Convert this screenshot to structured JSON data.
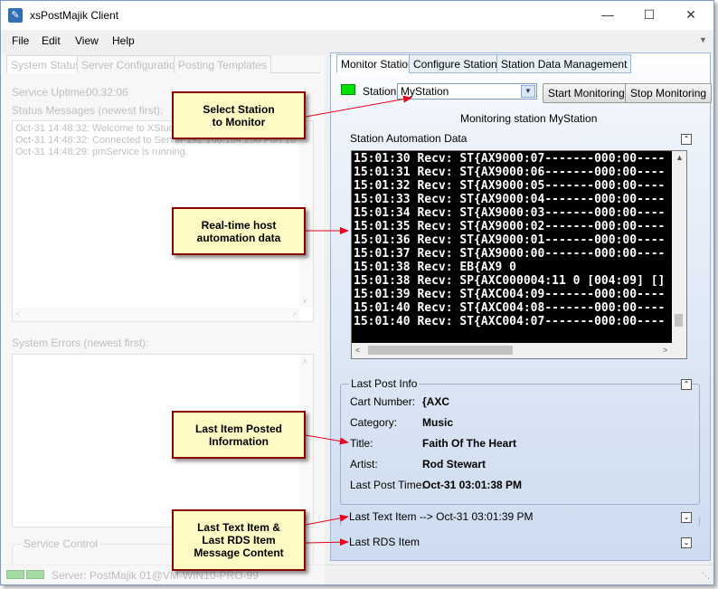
{
  "window": {
    "title": "xsPostMajik Client",
    "controls": [
      "minimize-icon",
      "maximize-icon",
      "close-icon"
    ]
  },
  "menu": [
    "File",
    "Edit",
    "View",
    "Help"
  ],
  "left_panel": {
    "tabs": [
      "System Status",
      "Server Configuration",
      "Posting Templates"
    ],
    "uptime_label": "Service Uptime:",
    "uptime_value": "00:32:06",
    "status_messages_label": "Status Messages (newest first):",
    "status_messages": [
      "Oct-31 14:48:32: Welcome to XStudio",
      "Oct-31 14:48:32: Connected to Server 192.168.184.250 Port 10",
      "Oct-31 14:48:29: pmService is running."
    ],
    "errors_label": "System Errors (newest first):",
    "service_control_label": "Service Control",
    "statusbar_text": "Server: PostMajik 01@VM-WIN10-PRO-99"
  },
  "right_panel": {
    "tabs": [
      "Monitor Station",
      "Configure Stations",
      "Station Data Management"
    ],
    "station_label": "Station",
    "station_value": "MyStation",
    "start_button": "Start Monitoring",
    "stop_button": "Stop Monitoring",
    "monitoring_status": "Monitoring station MyStation",
    "automation_label": "Station Automation Data",
    "automation_lines": [
      "15:01:30 Recv: ST{AX9000:07-------000:00----",
      "15:01:31 Recv: ST{AX9000:06-------000:00----",
      "15:01:32 Recv: ST{AX9000:05-------000:00----",
      "15:01:33 Recv: ST{AX9000:04-------000:00----",
      "15:01:34 Recv: ST{AX9000:03-------000:00----",
      "15:01:35 Recv: ST{AX9000:02-------000:00----",
      "15:01:36 Recv: ST{AX9000:01-------000:00----",
      "15:01:37 Recv: ST{AX9000:00-------000:00----",
      "15:01:38 Recv: EB{AX9 0",
      "15:01:38 Recv: SP{AXC000004:11 0 [004:09] []",
      "15:01:39 Recv: ST{AXC004:09-------000:00----",
      "15:01:40 Recv: ST{AXC004:08-------000:00----",
      "15:01:40 Recv: ST{AXC004:07-------000:00----"
    ],
    "last_post": {
      "header": "Last Post Info",
      "cart_label": "Cart Number:",
      "cart_value": "{AXC",
      "category_label": "Category:",
      "category_value": "Music",
      "title_label": "Title:",
      "title_value": "Faith Of The Heart",
      "artist_label": "Artist:",
      "artist_value": "Rod Stewart",
      "time_label": "Last Post Time:",
      "time_value": "Oct-31 03:01:38 PM"
    },
    "last_text_item": "Last Text Item --> Oct-31 03:01:39 PM",
    "last_rds_item": "Last RDS Item"
  },
  "callouts": {
    "select_station": "Select Station\nto Monitor",
    "realtime": "Real-time host\nautomation data",
    "last_item": "Last Item Posted\nInformation",
    "last_text": "Last Text Item &\nLast RDS Item\nMessage Content"
  },
  "colors": {
    "callout_bg": "#fff9c4",
    "callout_border": "#8b0000",
    "arrow": "#e8001c",
    "station_indicator": "#00e000",
    "terminal_bg": "#000000"
  }
}
